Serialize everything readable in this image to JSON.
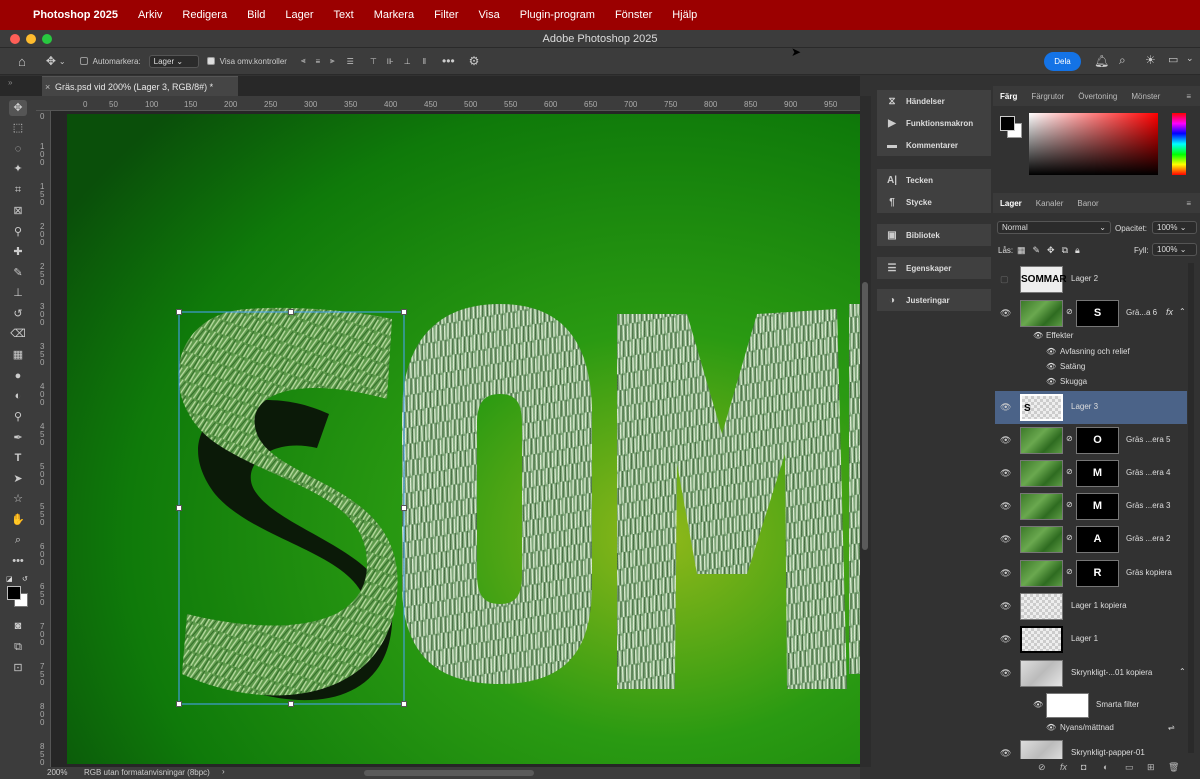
{
  "menubar": {
    "app_name": "Photoshop 2025",
    "items": [
      "Arkiv",
      "Redigera",
      "Bild",
      "Lager",
      "Text",
      "Markera",
      "Filter",
      "Visa",
      "Plugin-program",
      "Fönster",
      "Hjälp"
    ]
  },
  "window": {
    "title": "Adobe Photoshop 2025"
  },
  "options": {
    "autoselect_label": "Automarkera:",
    "autoselect_value": "Lager",
    "show_transform_label": "Visa omv.kontroller",
    "share_label": "Dela"
  },
  "document": {
    "tab_title": "Gräs.psd vid 200% (Lager 3, RGB/8#) *",
    "zoom": "200%",
    "status": "RGB utan formatanvisningar (8bpc)"
  },
  "rulers": {
    "h_ticks": [
      "0",
      "50",
      "100",
      "150",
      "200",
      "250",
      "300",
      "350",
      "400",
      "450",
      "500",
      "550",
      "600",
      "650",
      "700",
      "750",
      "800",
      "850",
      "900",
      "950"
    ],
    "v_ticks": [
      "0",
      "1 0 0",
      "1 5 0",
      "2 0 0",
      "2 5 0",
      "3 0 0",
      "3 5 0",
      "4 0 0",
      "4 5 0",
      "5 0 0",
      "5 5 0",
      "6 0 0",
      "6 5 0",
      "7 0 0",
      "7 5 0",
      "8 0 0",
      "8 5 0"
    ]
  },
  "side_panels": {
    "group1": [
      "Händelser",
      "Funktionsmakron",
      "Kommentarer"
    ],
    "group2": [
      "Tecken",
      "Stycke"
    ],
    "group3": [
      "Bibliotek"
    ],
    "group4": [
      "Egenskaper"
    ],
    "group5": [
      "Justeringar"
    ]
  },
  "color_panel": {
    "tabs": [
      "Färg",
      "Färgrutor",
      "Övertoning",
      "Mönster"
    ],
    "fg_color": "#000000",
    "bg_color": "#ffffff"
  },
  "layers_panel": {
    "tabs": [
      "Lager",
      "Kanaler",
      "Banor"
    ],
    "blend_mode": "Normal",
    "opacity_label": "Opacitet:",
    "opacity_value": "100%",
    "lock_label": "Lås:",
    "fill_label": "Fyll:",
    "fill_value": "100%",
    "layers": [
      {
        "name": "Lager 2",
        "thumb_text": "SOMMAR"
      },
      {
        "name": "Grä...a 6",
        "mask_text": "S",
        "fx": "fx"
      },
      {
        "name": "Lager 3",
        "thumb_text": "S"
      },
      {
        "name": "Gräs ...era 5",
        "mask_text": "O"
      },
      {
        "name": "Gräs ...era 4",
        "mask_text": "M"
      },
      {
        "name": "Gräs ...era 3",
        "mask_text": "M"
      },
      {
        "name": "Gräs ...era 2",
        "mask_text": "A"
      },
      {
        "name": "Gräs kopiera",
        "mask_text": "R"
      },
      {
        "name": "Lager 1 kopiera"
      },
      {
        "name": "Lager 1"
      },
      {
        "name": "Skrynkligt-...01 kopiera"
      },
      {
        "name": "Skrynkligt-papper-01"
      }
    ],
    "effects_label": "Effekter",
    "effects": [
      "Avfasning och relief",
      "Satäng",
      "Skugga"
    ],
    "smart_filters_label": "Smarta filter",
    "smart_filter_items": [
      "Nyans/mättnad"
    ]
  }
}
